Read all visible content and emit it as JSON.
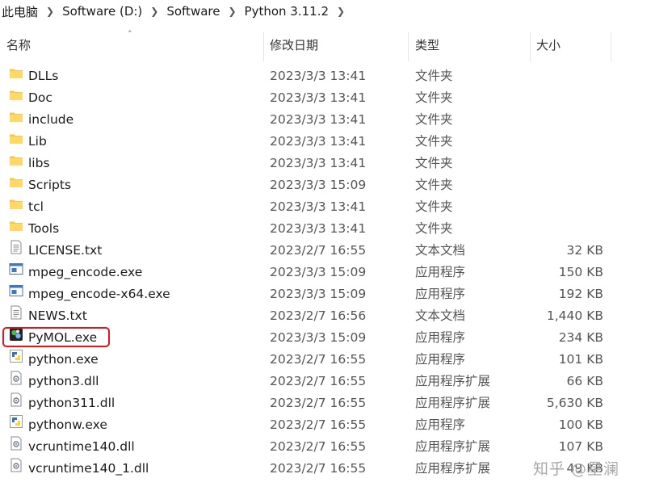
{
  "breadcrumb": {
    "items": [
      "此电脑",
      "Software (D:)",
      "Software",
      "Python 3.11.2"
    ]
  },
  "columns": {
    "name": "名称",
    "date": "修改日期",
    "type": "类型",
    "size": "大小"
  },
  "files": [
    {
      "name": "DLLs",
      "date": "2023/3/3 13:41",
      "type": "文件夹",
      "size": "",
      "icon": "folder-icon"
    },
    {
      "name": "Doc",
      "date": "2023/3/3 13:41",
      "type": "文件夹",
      "size": "",
      "icon": "folder-icon"
    },
    {
      "name": "include",
      "date": "2023/3/3 13:41",
      "type": "文件夹",
      "size": "",
      "icon": "folder-icon"
    },
    {
      "name": "Lib",
      "date": "2023/3/3 13:41",
      "type": "文件夹",
      "size": "",
      "icon": "folder-icon"
    },
    {
      "name": "libs",
      "date": "2023/3/3 13:41",
      "type": "文件夹",
      "size": "",
      "icon": "folder-icon"
    },
    {
      "name": "Scripts",
      "date": "2023/3/3 15:09",
      "type": "文件夹",
      "size": "",
      "icon": "folder-icon"
    },
    {
      "name": "tcl",
      "date": "2023/3/3 13:41",
      "type": "文件夹",
      "size": "",
      "icon": "folder-icon"
    },
    {
      "name": "Tools",
      "date": "2023/3/3 13:41",
      "type": "文件夹",
      "size": "",
      "icon": "folder-icon"
    },
    {
      "name": "LICENSE.txt",
      "date": "2023/2/7 16:55",
      "type": "文本文档",
      "size": "32 KB",
      "icon": "text-file-icon"
    },
    {
      "name": "mpeg_encode.exe",
      "date": "2023/3/3 15:09",
      "type": "应用程序",
      "size": "150 KB",
      "icon": "app-window-icon"
    },
    {
      "name": "mpeg_encode-x64.exe",
      "date": "2023/3/3 15:09",
      "type": "应用程序",
      "size": "192 KB",
      "icon": "app-window-icon"
    },
    {
      "name": "NEWS.txt",
      "date": "2023/2/7 16:56",
      "type": "文本文档",
      "size": "1,440 KB",
      "icon": "text-file-icon"
    },
    {
      "name": "PyMOL.exe",
      "date": "2023/3/3 15:09",
      "type": "应用程序",
      "size": "234 KB",
      "icon": "pymol-icon"
    },
    {
      "name": "python.exe",
      "date": "2023/2/7 16:55",
      "type": "应用程序",
      "size": "101 KB",
      "icon": "python-icon"
    },
    {
      "name": "python3.dll",
      "date": "2023/2/7 16:55",
      "type": "应用程序扩展",
      "size": "66 KB",
      "icon": "dll-file-icon"
    },
    {
      "name": "python311.dll",
      "date": "2023/2/7 16:55",
      "type": "应用程序扩展",
      "size": "5,630 KB",
      "icon": "dll-file-icon"
    },
    {
      "name": "pythonw.exe",
      "date": "2023/2/7 16:55",
      "type": "应用程序",
      "size": "100 KB",
      "icon": "python-icon"
    },
    {
      "name": "vcruntime140.dll",
      "date": "2023/2/7 16:55",
      "type": "应用程序扩展",
      "size": "107 KB",
      "icon": "dll-file-icon"
    },
    {
      "name": "vcruntime140_1.dll",
      "date": "2023/2/7 16:55",
      "type": "应用程序扩展",
      "size": "49 KB",
      "icon": "dll-file-icon"
    }
  ],
  "watermark": "知乎 @星澜"
}
